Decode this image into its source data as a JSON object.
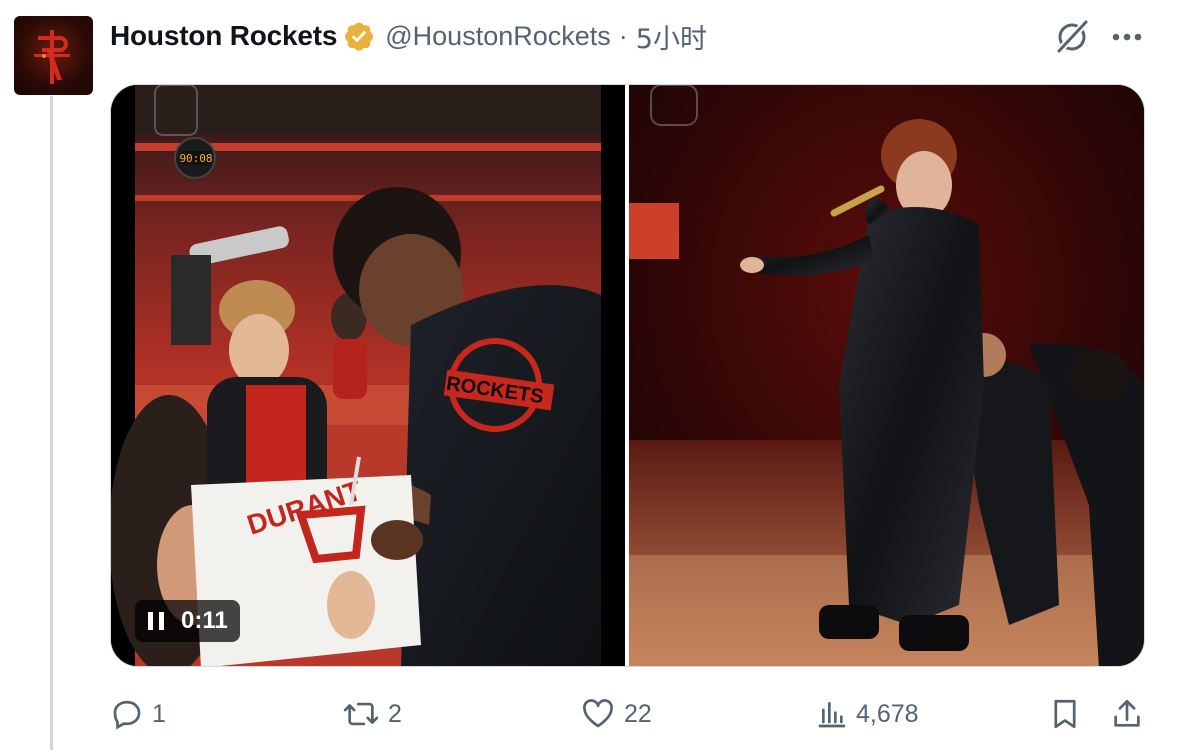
{
  "tweet": {
    "author": {
      "display_name": "Houston Rockets",
      "handle": "@HoustonRockets",
      "verified": true,
      "verified_color": "#e8b33c",
      "avatar_icon": "rockets-logo"
    },
    "separator": "·",
    "time": "5小时",
    "media": {
      "video_time": "0:11",
      "play_state_icon": "pause-icon",
      "overlays": {
        "shot_clock": "90:08",
        "banner": "ROCKETS"
      }
    },
    "actions": {
      "reply": {
        "icon": "reply-icon",
        "count": "1"
      },
      "repost": {
        "icon": "repost-icon",
        "count": "2"
      },
      "like": {
        "icon": "heart-icon",
        "count": "22"
      },
      "views": {
        "icon": "views-icon",
        "count": "4,678"
      },
      "bookmark": {
        "icon": "bookmark-icon"
      },
      "share": {
        "icon": "share-icon"
      }
    }
  },
  "colors": {
    "text_primary": "#0f1419",
    "text_secondary": "#536471",
    "border": "#cfd9de",
    "rockets_red": "#ce1141"
  }
}
